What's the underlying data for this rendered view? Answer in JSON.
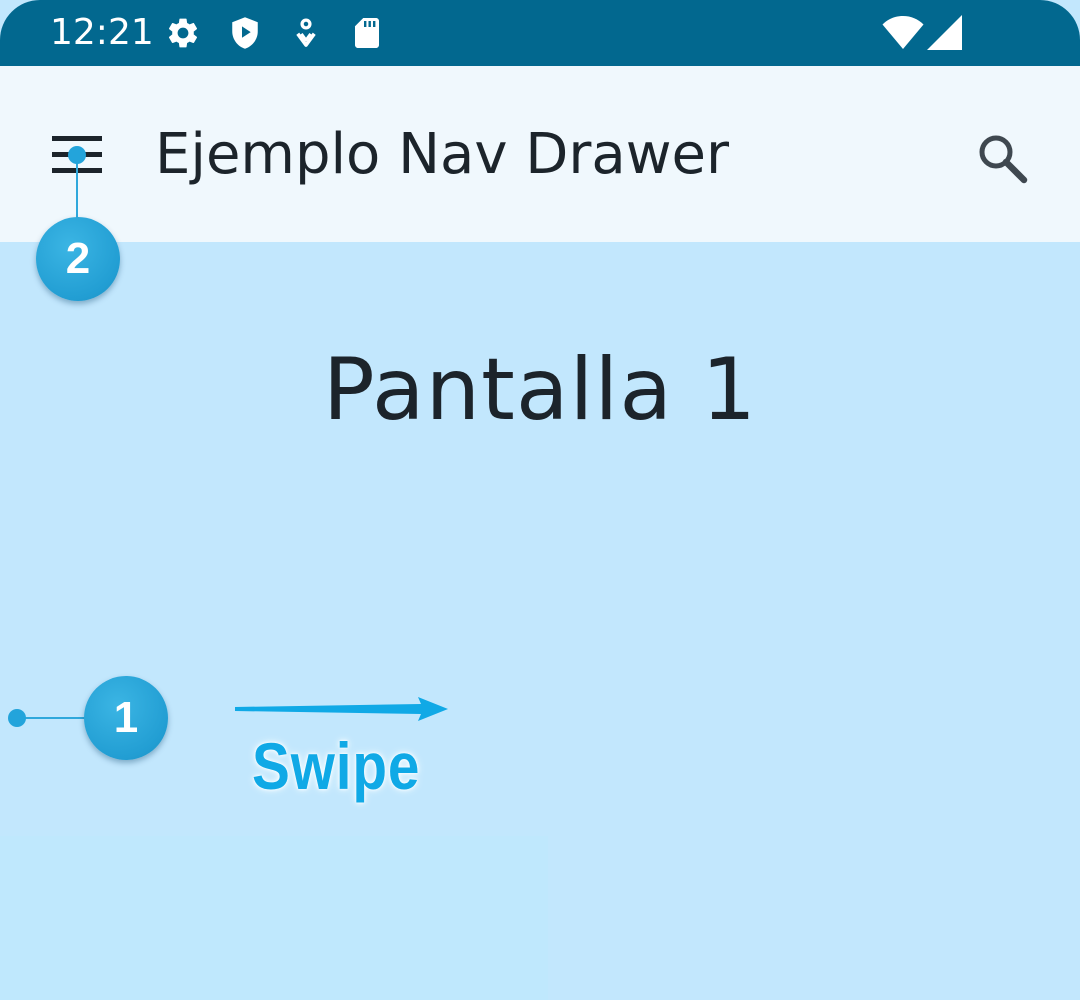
{
  "status_bar": {
    "time": "12:21",
    "left_icons": [
      "settings-icon",
      "play-protect-icon",
      "location-icon",
      "sd-card-icon"
    ],
    "right_icons": [
      "wifi-icon",
      "cellular-signal-icon"
    ],
    "background": "#02688f"
  },
  "app_bar": {
    "title": "Ejemplo Nav Drawer",
    "menu_icon": "hamburger-menu-icon",
    "search_icon": "search-icon",
    "background": "#f0f8fd"
  },
  "content": {
    "title": "Pantalla 1",
    "background": "#c2e7fd"
  },
  "annotations": {
    "swipe_marker": "1",
    "menu_marker": "2",
    "swipe_label": "Swipe",
    "accent": "#10a9e6"
  }
}
